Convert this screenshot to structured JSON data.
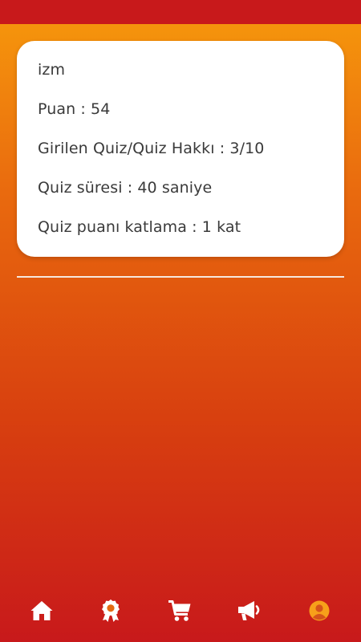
{
  "profile": {
    "username": "izm",
    "points_line": "Puan : 54",
    "quiz_entries_line": "Girilen Quiz/Quiz Hakkı : 3/10",
    "quiz_duration_line": "Quiz süresi : 40 saniye",
    "quiz_multiplier_line": "Quiz puanı katlama : 1 kat"
  },
  "bottom_nav": {
    "items": [
      {
        "icon": "home-icon",
        "active": false
      },
      {
        "icon": "award-icon",
        "active": false
      },
      {
        "icon": "shopping-cart-icon",
        "active": false
      },
      {
        "icon": "megaphone-icon",
        "active": false
      },
      {
        "icon": "user-circle-icon",
        "active": true
      }
    ]
  },
  "colors": {
    "gradient_top": "#f79a0c",
    "gradient_bottom": "#c8191b",
    "status_bar": "#c8191b",
    "card_background": "#ffffff",
    "text": "#3a3a3a",
    "nav_icon": "#ffffff",
    "nav_icon_active": "#f7a01a"
  }
}
